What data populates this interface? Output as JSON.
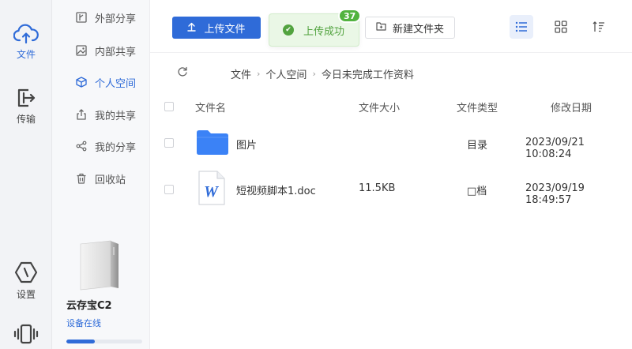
{
  "rail": {
    "files_label": "文件",
    "transfer_label": "传输",
    "settings_label": "设置"
  },
  "sidenav": {
    "items": [
      {
        "label": "外部分享"
      },
      {
        "label": "内部共享"
      },
      {
        "label": "个人空间"
      },
      {
        "label": "我的共享"
      },
      {
        "label": "我的分享"
      },
      {
        "label": "回收站"
      }
    ],
    "active_index": 2,
    "device": {
      "name": "云存宝C2",
      "status": "设备在线",
      "usage_percent": 38
    }
  },
  "toolbar": {
    "upload_label": "上传文件",
    "toast_label": "上传成功",
    "badge_count": "37",
    "new_folder_label": "新建文件夹"
  },
  "breadcrumb": [
    "文件",
    "个人空间",
    "今日未完成工作资料"
  ],
  "table": {
    "headers": {
      "name": "文件名",
      "size": "文件大小",
      "type": "文件类型",
      "modified": "修改日期"
    },
    "rows": [
      {
        "name": "图片",
        "size": "",
        "type": "目录",
        "modified": "2023/09/21 10:08:24",
        "icon": "folder-icon"
      },
      {
        "name": "短视频脚本1.doc",
        "size": "11.5KB",
        "type": "□档",
        "modified": "2023/09/19 18:49:57",
        "icon": "word-doc-icon"
      }
    ]
  },
  "colors": {
    "accent": "#2f6bd8",
    "success": "#52a33f",
    "folder": "#3b82f6"
  }
}
